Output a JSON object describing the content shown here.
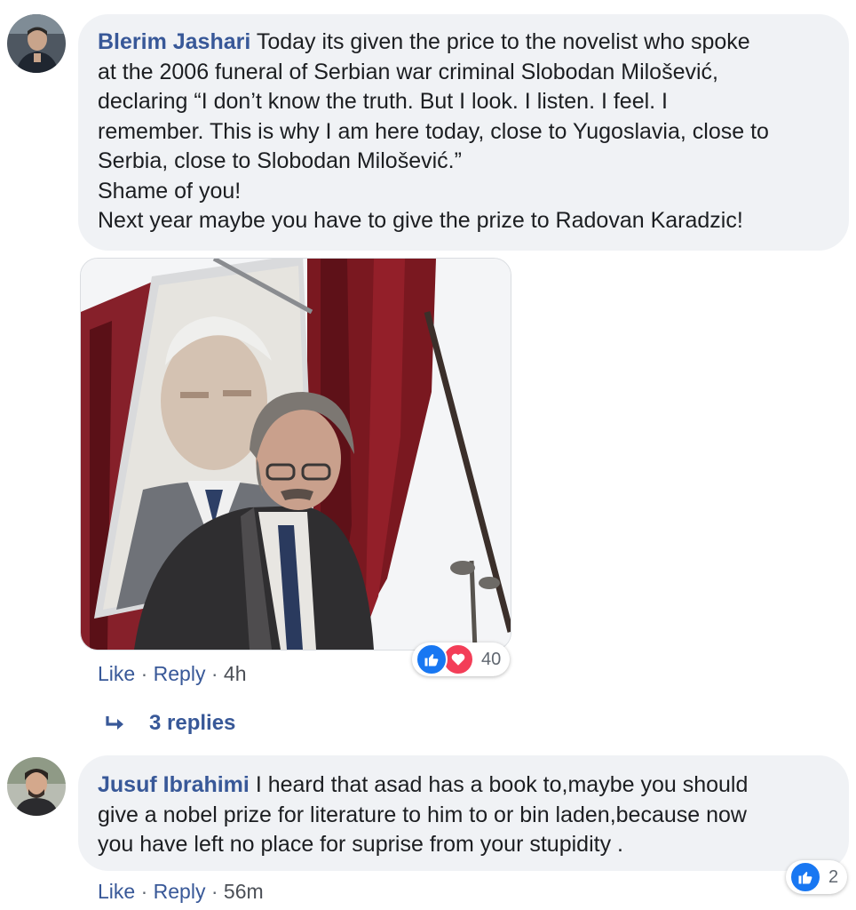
{
  "comments": [
    {
      "author": "Blerim Jashari",
      "lines": [
        "Today its given the price to the novelist who spoke",
        "at the 2006 funeral of Serbian war criminal Slobodan Milošević,",
        "declaring “I don’t know the truth. But I look. I listen. I feel. I",
        "remember. This is why I am here today, close to Yugoslavia, close to",
        "Serbia, close to Slobodan Milošević.”",
        "Shame of you!",
        "Next year maybe you have to give the prize to Radovan Karadzic!"
      ],
      "reaction_count": "40",
      "actions": {
        "like": "Like",
        "reply": "Reply",
        "sep": "·",
        "time": "4h"
      },
      "replies_label": "3 replies"
    },
    {
      "author": "Jusuf Ibrahimi",
      "lines": [
        "I heard that asad has a book to,maybe you should",
        "give a nobel prize for literature to him to or bin laden,because now",
        "you have left no place for suprise from your stupidity ."
      ],
      "reaction_count": "2",
      "actions": {
        "like": "Like",
        "reply": "Reply",
        "sep": "·",
        "time": "56m"
      }
    }
  ],
  "icons": {
    "like_reaction": "thumbs-up-icon",
    "love_reaction": "heart-icon",
    "replies_arrow": "reply-arrow-icon"
  },
  "colors": {
    "author_link": "#385898",
    "bubble_bg": "#f0f2f5",
    "like_blue": "#1877f2",
    "love_red": "#f33e58"
  }
}
